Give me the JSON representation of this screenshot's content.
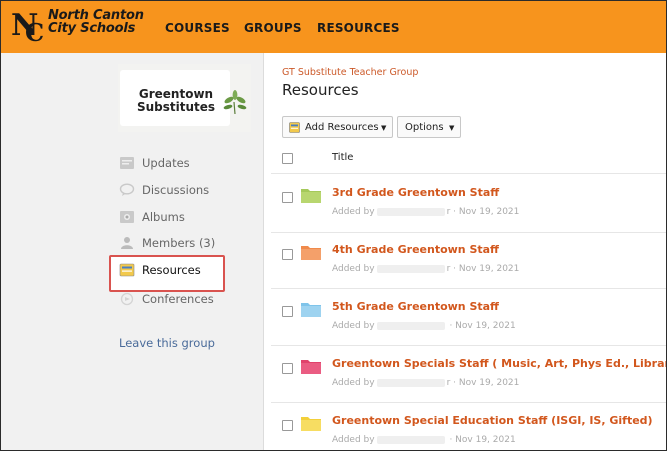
{
  "header": {
    "logo_text_line1": "North Canton",
    "logo_text_line2": "City Schools",
    "nav": [
      "COURSES",
      "GROUPS",
      "RESOURCES"
    ]
  },
  "sidebar": {
    "group_image_text_line1": "Greentown",
    "group_image_text_line2": "Substitutes",
    "items": [
      {
        "label": "Updates",
        "icon": "updates-icon"
      },
      {
        "label": "Discussions",
        "icon": "discussions-icon"
      },
      {
        "label": "Albums",
        "icon": "albums-icon"
      },
      {
        "label": "Members (3)",
        "icon": "members-icon"
      },
      {
        "label": "Resources",
        "icon": "resources-icon",
        "active": true
      },
      {
        "label": "Conferences",
        "icon": "conferences-icon"
      }
    ],
    "leave_label": "Leave this group"
  },
  "main": {
    "breadcrumb": "GT Substitute Teacher Group",
    "title": "Resources",
    "add_resources_label": "Add Resources",
    "options_label": "Options",
    "column_title": "Title",
    "rows": [
      {
        "name": "3rd Grade Greentown Staff",
        "added_by": "Added by",
        "name_tail": "r",
        "date": "· Nov 19, 2021",
        "folder_color": "#a5c95a"
      },
      {
        "name": "4th Grade Greentown Staff",
        "added_by": "Added by",
        "name_tail": "r",
        "date": "· Nov 19, 2021",
        "folder_color": "#f08a4b"
      },
      {
        "name": "5th Grade Greentown Staff",
        "added_by": "Added by",
        "name_tail": "",
        "date": "· Nov 19, 2021",
        "folder_color": "#7fc4ea"
      },
      {
        "name": "Greentown Specials Staff ( Music, Art, Phys Ed., Library, Tech)",
        "added_by": "Added by",
        "name_tail": "r",
        "date": "· Nov 19, 2021",
        "folder_color": "#e0426b"
      },
      {
        "name": "Greentown Special Education Staff (ISGI, IS, Gifted)",
        "added_by": "Added by",
        "name_tail": "",
        "date": "· Nov 19, 2021",
        "folder_color": "#f3d03a"
      }
    ]
  },
  "colors": {
    "brand": "#f7941d",
    "link": "#d2571d",
    "highlight": "#d9534f"
  }
}
